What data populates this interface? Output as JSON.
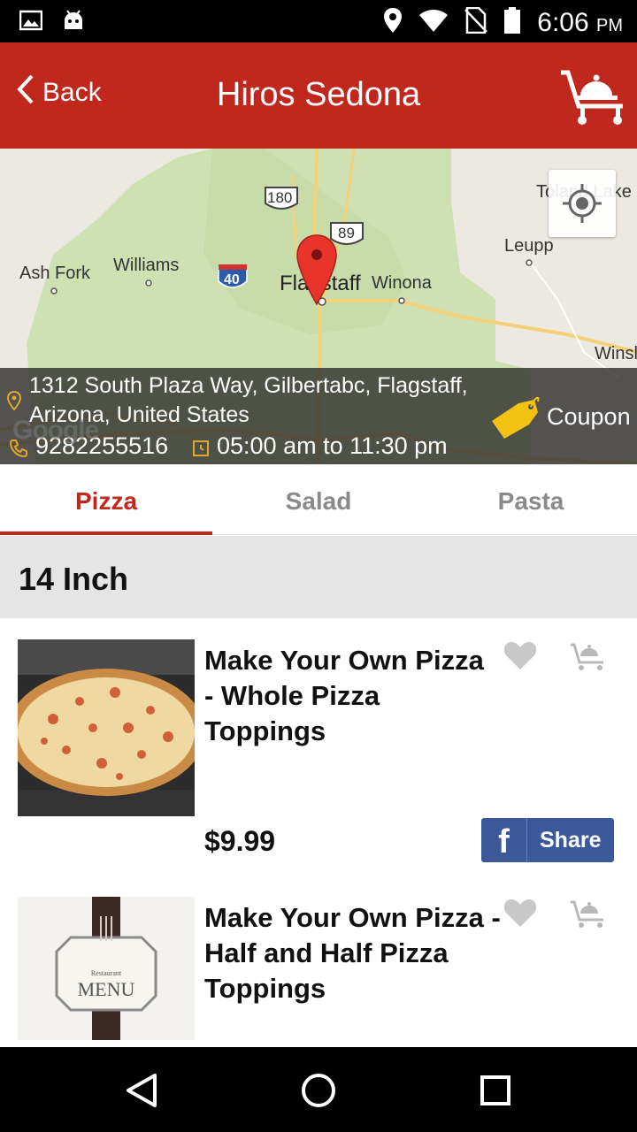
{
  "status_bar": {
    "time": "6:06",
    "ampm": "PM"
  },
  "header": {
    "back_label": "Back",
    "title": "Hiros Sedona"
  },
  "map": {
    "labels": {
      "ash_fork": "Ash Fork",
      "williams": "Williams",
      "flagstaff": "Flagstaff",
      "winona": "Winona",
      "leupp": "Leupp",
      "toland_lake": "Toland Lake",
      "winslow": "Winsl"
    },
    "shields": {
      "us180": "180",
      "us89": "89",
      "i40": "40"
    },
    "google": "Google"
  },
  "restaurant": {
    "address": "1312 South Plaza Way, Gilbertabc, Flagstaff, Arizona, United States",
    "phone": "9282255516",
    "hours": "05:00 am to 11:30 pm",
    "coupon_label": "Coupon"
  },
  "tabs": [
    {
      "label": "Pizza",
      "active": true
    },
    {
      "label": "Salad",
      "active": false
    },
    {
      "label": "Pasta",
      "active": false
    }
  ],
  "section": {
    "title": "14 Inch"
  },
  "items": [
    {
      "name": "Make Your Own Pizza - Whole Pizza Toppings",
      "price": "$9.99",
      "share_label": "Share"
    },
    {
      "name": "Make Your Own Pizza - Half and Half Pizza Toppings",
      "menu_card_title": "Restaurant",
      "menu_card_word": "MENU"
    }
  ],
  "colors": {
    "brand_red": "#c0281e",
    "facebook_blue": "#3b5998",
    "coupon_yellow": "#f2c313"
  }
}
